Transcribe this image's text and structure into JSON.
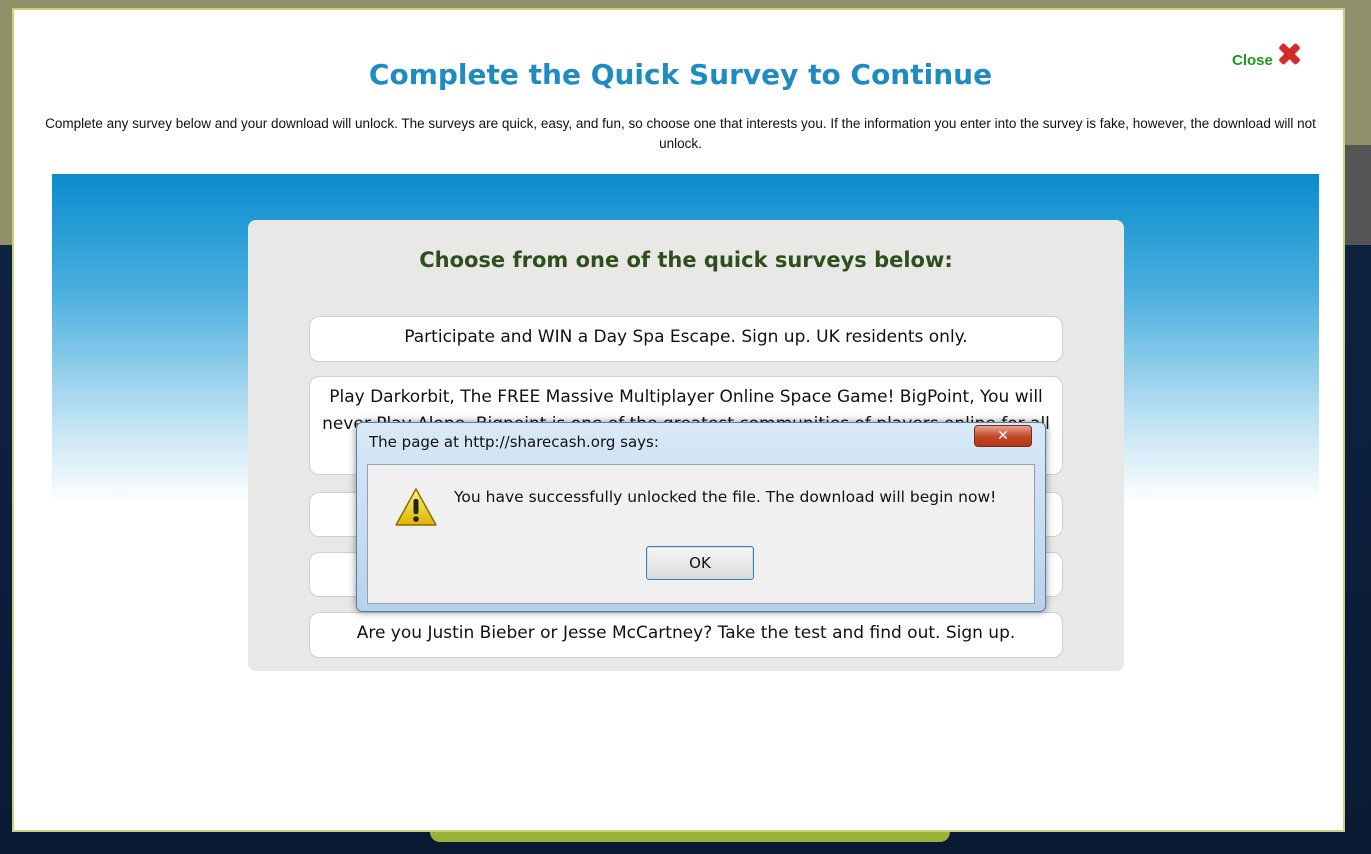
{
  "modal": {
    "close_label": "Close",
    "title": "Complete the Quick Survey to Continue",
    "description": "Complete any survey below and your download will unlock. The surveys are quick, easy, and fun, so choose one that interests you. If the information you enter into the survey is fake, however, the download will not unlock."
  },
  "surveys": {
    "heading": "Choose from one of the quick surveys below:",
    "offers": [
      "Participate and WIN a Day Spa Escape. Sign up. UK residents only.",
      "Play Darkorbit, The FREE Massive Multiplayer Online Space Game! BigPoint, You will never Play Alone. Bigpoint is one of the greatest communities of players online for all kinds of games. Sign up.",
      "",
      "",
      "Are you Justin Bieber or Jesse McCartney? Take the test and find out. Sign up."
    ]
  },
  "dialog": {
    "title": "The page at http://sharecash.org says:",
    "close_glyph": "✕",
    "message": "You have successfully unlocked the file. The download will begin now!",
    "ok_label": "OK"
  },
  "colors": {
    "title_blue": "#1e8bc3",
    "heading_green": "#2e4f1c",
    "close_green": "#1d9a1d",
    "close_red": "#d42a2a"
  }
}
